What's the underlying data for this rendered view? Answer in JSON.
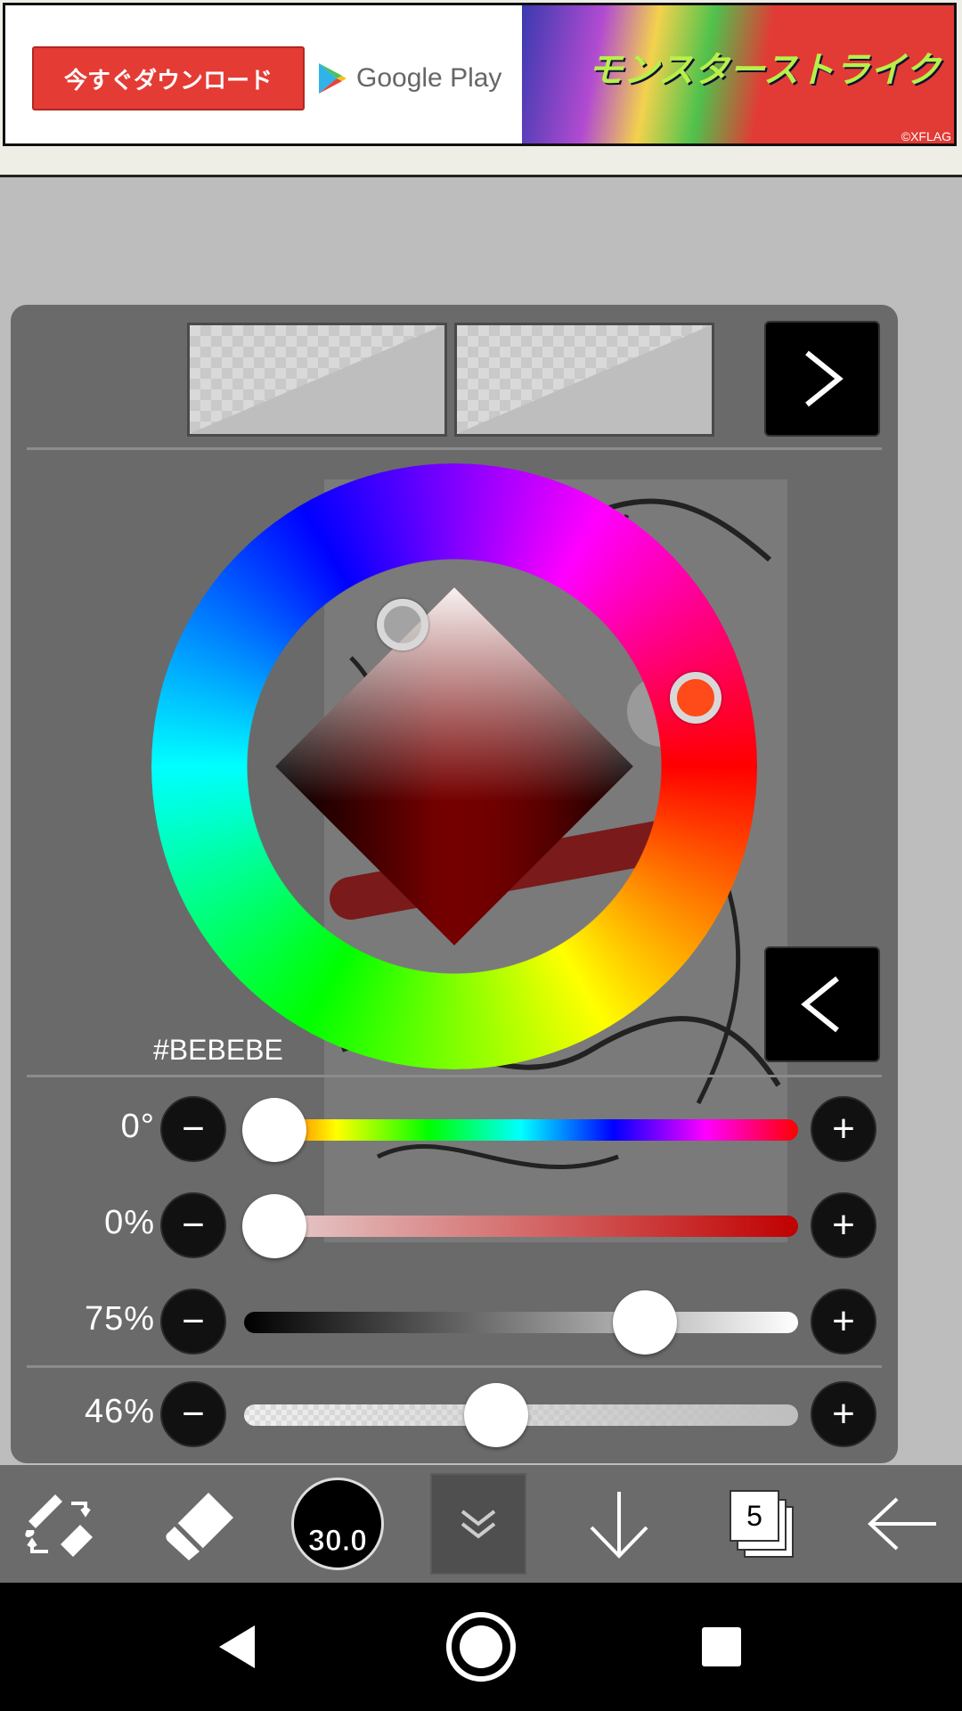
{
  "ad": {
    "button_label": "今すぐダウンロード",
    "store_label": "Google Play",
    "game_logo": "モンスターストライク",
    "copyright": "©XFLAG"
  },
  "color_panel": {
    "hex_value": "#BEBEBE",
    "current_color": "#bebebe",
    "selected_hue_color": "#ff4a1a",
    "sliders": [
      {
        "id": "hue",
        "label": "0°",
        "value_fraction": 0.0
      },
      {
        "id": "saturation",
        "label": "0%",
        "value_fraction": 0.0
      },
      {
        "id": "brightness",
        "label": "75%",
        "value_fraction": 0.75
      },
      {
        "id": "opacity",
        "label": "46%",
        "value_fraction": 0.46
      }
    ],
    "minus_glyph": "−",
    "plus_glyph": "+"
  },
  "toolbar": {
    "brush_size": "30.0",
    "layer_count": "5",
    "icons": [
      "tool-switch-icon",
      "eraser-icon",
      "chevron-double-down-icon",
      "arrow-down-icon",
      "layers-icon",
      "arrow-left-icon"
    ]
  },
  "system_nav": {
    "icons": [
      "back-icon",
      "home-icon",
      "recents-icon"
    ]
  }
}
